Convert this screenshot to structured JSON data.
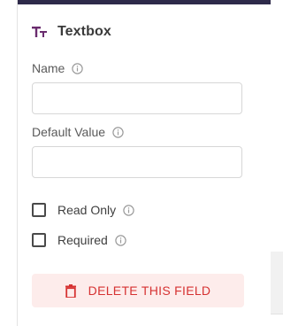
{
  "header": {
    "title": "Textbox",
    "icon": "text-type-icon",
    "icon_color": "#6a2c6e"
  },
  "fields": {
    "name": {
      "label": "Name",
      "value": "",
      "info_icon": "info-icon"
    },
    "default_value": {
      "label": "Default Value",
      "value": "",
      "info_icon": "info-icon"
    }
  },
  "options": {
    "read_only": {
      "label": "Read Only",
      "checked": false,
      "info_icon": "info-icon"
    },
    "required": {
      "label": "Required",
      "checked": false,
      "info_icon": "info-icon"
    }
  },
  "actions": {
    "delete_label": "DELETE THIS FIELD",
    "delete_icon": "trash-icon",
    "delete_color": "#d63232",
    "delete_bg": "#fdeceb"
  },
  "colors": {
    "top_bar": "#2e2a4a",
    "border": "#d7d7d7"
  }
}
